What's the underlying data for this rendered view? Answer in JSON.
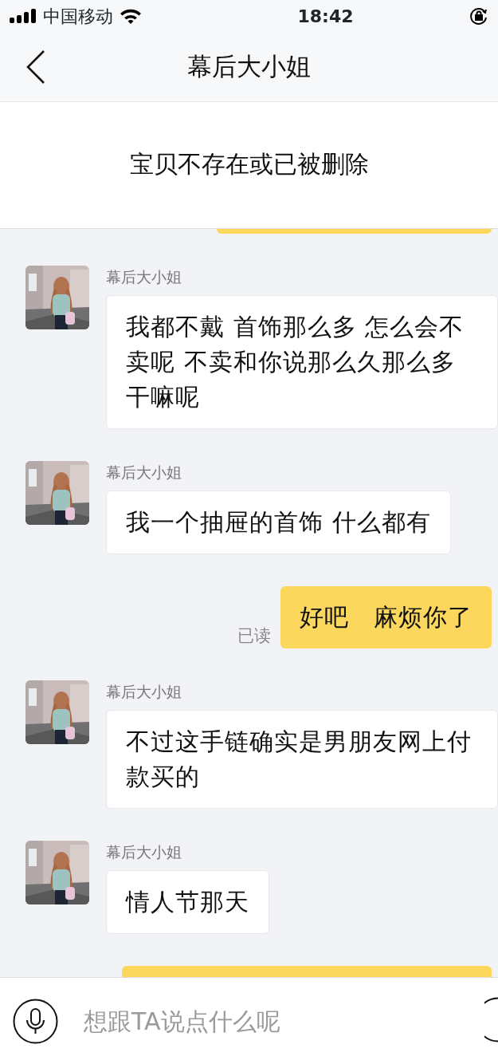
{
  "status_bar": {
    "carrier": "中国移动",
    "time": "18:42"
  },
  "header": {
    "title": "幕后大小姐"
  },
  "banner": {
    "text": "宝贝不存在或已被删除"
  },
  "messages": [
    {
      "kind": "partial_outgoing"
    },
    {
      "kind": "incoming",
      "sender": "幕后大小姐",
      "text": "我都不戴 首饰那么多 怎么会不卖呢 不卖和你说那么久那么多干嘛呢"
    },
    {
      "kind": "incoming",
      "sender": "幕后大小姐",
      "text": "我一个抽屉的首饰 什么都有"
    },
    {
      "kind": "outgoing",
      "text": "好吧　麻烦你了",
      "read_label": "已读"
    },
    {
      "kind": "incoming",
      "sender": "幕后大小姐",
      "text": "不过这手链确实是男朋友网上付款买的"
    },
    {
      "kind": "incoming",
      "sender": "幕后大小姐",
      "text": "情人节那天"
    },
    {
      "kind": "partial_outgoing"
    }
  ],
  "input_bar": {
    "placeholder": "想跟TA说点什么呢"
  }
}
